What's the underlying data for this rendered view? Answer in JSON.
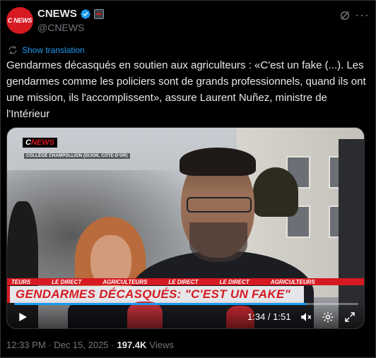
{
  "account": {
    "avatar_text": "C NEWS",
    "name": "CNEWS",
    "handle": "@CNEWS"
  },
  "icons": {
    "verified": "verified-badge-icon",
    "affiliate": "affiliate-badge-icon",
    "grok": "grok-icon",
    "more": "more-options-icon",
    "translate": "translate-icon",
    "play": "play-icon",
    "volume": "volume-icon",
    "settings": "gear-icon",
    "fullscreen": "fullscreen-icon"
  },
  "colors": {
    "background": "#000000",
    "text": "#e7e9ea",
    "secondary": "#71767b",
    "link": "#1d9bf0",
    "verified": "#1d9bf0",
    "brand_red": "#d71921"
  },
  "show_translation": "Show translation",
  "tweet_text": "Gendarmes décasqués en soutien aux agriculteurs : «C'est un fake (...). Les gendarmes comme les policiers sont de grands professionnels, quand ils ont une mission, ils l'accomplissent», assure Laurent Nuñez, ministre de l'Intérieur",
  "video": {
    "channel_logo_c": "C",
    "channel_logo_news": "NEWS",
    "location": "COLLÈGE CHAMPOLLION (DIJON, CÔTE-D'OR)",
    "ticker": [
      "TEURS",
      "LE DIRECT",
      "AGRICULTEURS",
      "LE DIRECT",
      "LE DIRECT",
      "AGRICULTEURS"
    ],
    "headline": "GENDARMES DÉCASQUÉS: \"C'EST UN FAKE\"",
    "time": "1:34 / 1:51",
    "progress": 0.85
  },
  "meta": {
    "time": "12:33 PM · Dec 15, 2025 ·",
    "views_count": "197.4K",
    "views_label": "Views"
  }
}
